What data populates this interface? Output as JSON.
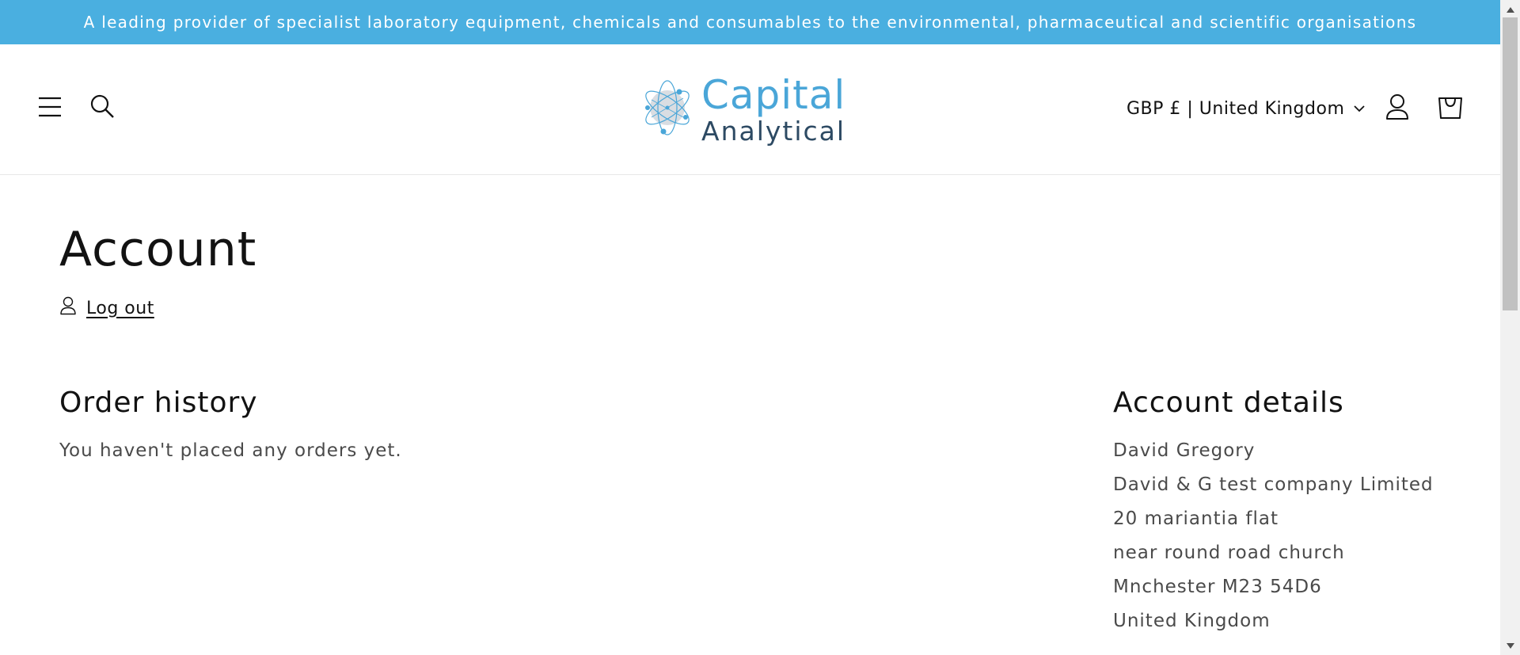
{
  "announcement": {
    "text": "A leading provider of specialist laboratory equipment, chemicals and consumables to the environmental, pharmaceutical and scientific organisations",
    "background": "#4aafe0"
  },
  "header": {
    "logo": {
      "main": "Capital",
      "sub": "Analytical"
    },
    "country_selector": "GBP £ | United Kingdom",
    "icons": [
      "menu-icon",
      "search-icon",
      "account-icon",
      "cart-icon",
      "chevron-down-icon"
    ]
  },
  "account": {
    "title": "Account",
    "logout_label": "Log out",
    "order_history": {
      "title": "Order history",
      "empty_message": "You haven't placed any orders yet."
    },
    "details": {
      "title": "Account details",
      "lines": [
        "David Gregory",
        "David & G test company Limited",
        "20 mariantia flat",
        "near round road church",
        "Mnchester M23 54D6",
        "United Kingdom"
      ]
    }
  },
  "colors": {
    "accent": "#4aafe0",
    "text": "#121212",
    "muted_text": "#4a4a4a",
    "logo_blue": "#4aa6d8",
    "logo_navy": "#2d4a63"
  }
}
